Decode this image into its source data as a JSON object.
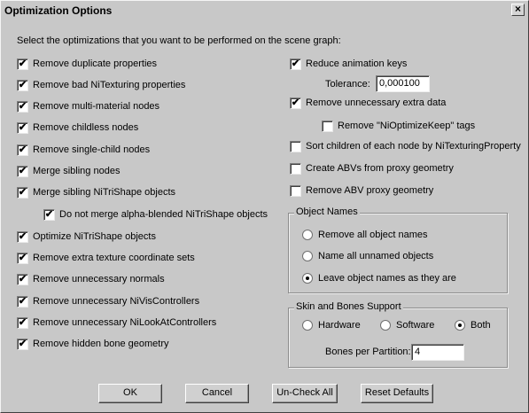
{
  "window": {
    "title": "Optimization Options",
    "close_label": "×"
  },
  "intro": "Select the optimizations that you want to be performed on the scene graph:",
  "left_options": [
    {
      "label": "Remove duplicate properties",
      "checked": true
    },
    {
      "label": "Remove bad NiTexturing properties",
      "checked": true
    },
    {
      "label": "Remove multi-material nodes",
      "checked": true
    },
    {
      "label": "Remove childless nodes",
      "checked": true
    },
    {
      "label": "Remove single-child nodes",
      "checked": true
    },
    {
      "label": "Merge sibling nodes",
      "checked": true
    },
    {
      "label": "Merge sibling NiTriShape objects",
      "checked": true
    },
    {
      "label": "Do not merge alpha-blended NiTriShape objects",
      "checked": true
    },
    {
      "label": "Optimize NiTriShape objects",
      "checked": true
    },
    {
      "label": "Remove extra texture coordinate sets",
      "checked": true
    },
    {
      "label": "Remove unnecessary normals",
      "checked": true
    },
    {
      "label": "Remove unnecessary NiVisControllers",
      "checked": true
    },
    {
      "label": "Remove unnecessary NiLookAtControllers",
      "checked": true
    },
    {
      "label": "Remove hidden bone geometry",
      "checked": true
    }
  ],
  "right_options": [
    {
      "label": "Reduce animation keys",
      "checked": true
    },
    {
      "label": "Remove unnecessary extra data",
      "checked": true
    },
    {
      "label": "Remove \"NiOptimizeKeep\" tags",
      "checked": false
    },
    {
      "label": "Sort children of each node by NiTexturingProperty",
      "checked": false
    },
    {
      "label": "Create ABVs from proxy geometry",
      "checked": false
    },
    {
      "label": "Remove ABV proxy geometry",
      "checked": false
    }
  ],
  "tolerance": {
    "label": "Tolerance:",
    "value": "0,000100"
  },
  "object_names": {
    "legend": "Object Names",
    "options": [
      {
        "label": "Remove all object names",
        "selected": false
      },
      {
        "label": "Name all unnamed objects",
        "selected": false
      },
      {
        "label": "Leave object names as they are",
        "selected": true
      }
    ]
  },
  "skin_bones": {
    "legend": "Skin and Bones Support",
    "options": [
      {
        "label": "Hardware",
        "selected": false
      },
      {
        "label": "Software",
        "selected": false
      },
      {
        "label": "Both",
        "selected": true
      }
    ],
    "bones_label": "Bones per Partition:",
    "bones_value": "4"
  },
  "buttons": {
    "ok": "OK",
    "cancel": "Cancel",
    "uncheck_all": "Un-Check All",
    "reset_defaults": "Reset Defaults"
  }
}
